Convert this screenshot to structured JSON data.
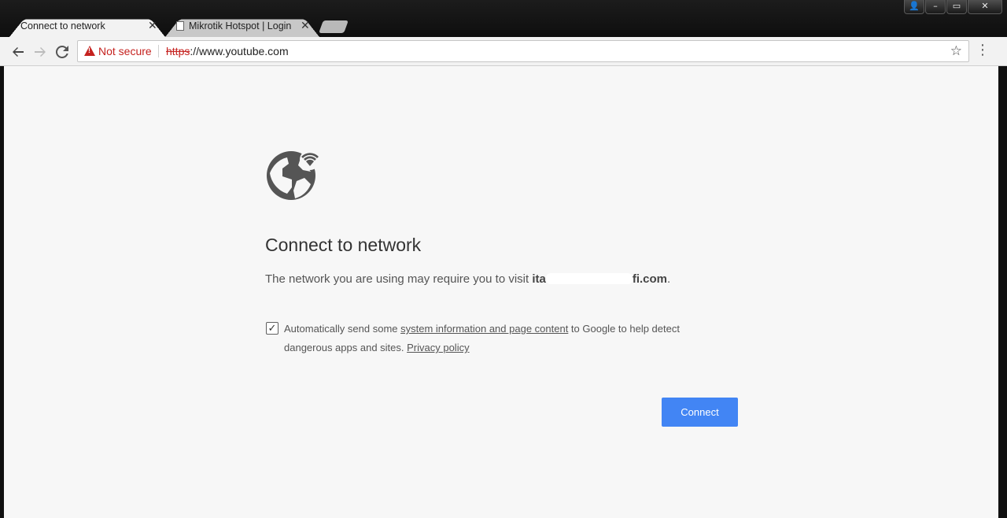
{
  "browser": {
    "tabs": [
      {
        "title": "Connect to network",
        "close": "✕",
        "active": true
      },
      {
        "title": "Mikrotik Hotspot | Login",
        "close": "✕",
        "active": false
      }
    ],
    "window_controls": {
      "user": "👤",
      "minimize": "–",
      "maximize": "▭",
      "close": "✕"
    }
  },
  "toolbar": {
    "back_icon": "arrow-left",
    "forward_icon": "arrow-right",
    "reload_icon": "reload",
    "security_label": "Not secure",
    "url_scheme": "https",
    "url_rest": "://www.youtube.com",
    "bookmark_icon": "star",
    "menu_icon": "more-vert"
  },
  "page": {
    "heading": "Connect to network",
    "description_prefix": "The network you are using may require you to visit",
    "host_visible_prefix": "ita",
    "host_visible_suffix": "fi.com",
    "description_suffix": ".",
    "consent_text_1": "Automatically send some ",
    "consent_link": "system information and page content",
    "consent_text_2": " to Google to help detect dangerous apps and sites. ",
    "privacy_link": "Privacy policy",
    "checkbox_checked": true,
    "connect_label": "Connect",
    "accent_color": "#4285f4",
    "icon": "network-globe-wifi"
  }
}
